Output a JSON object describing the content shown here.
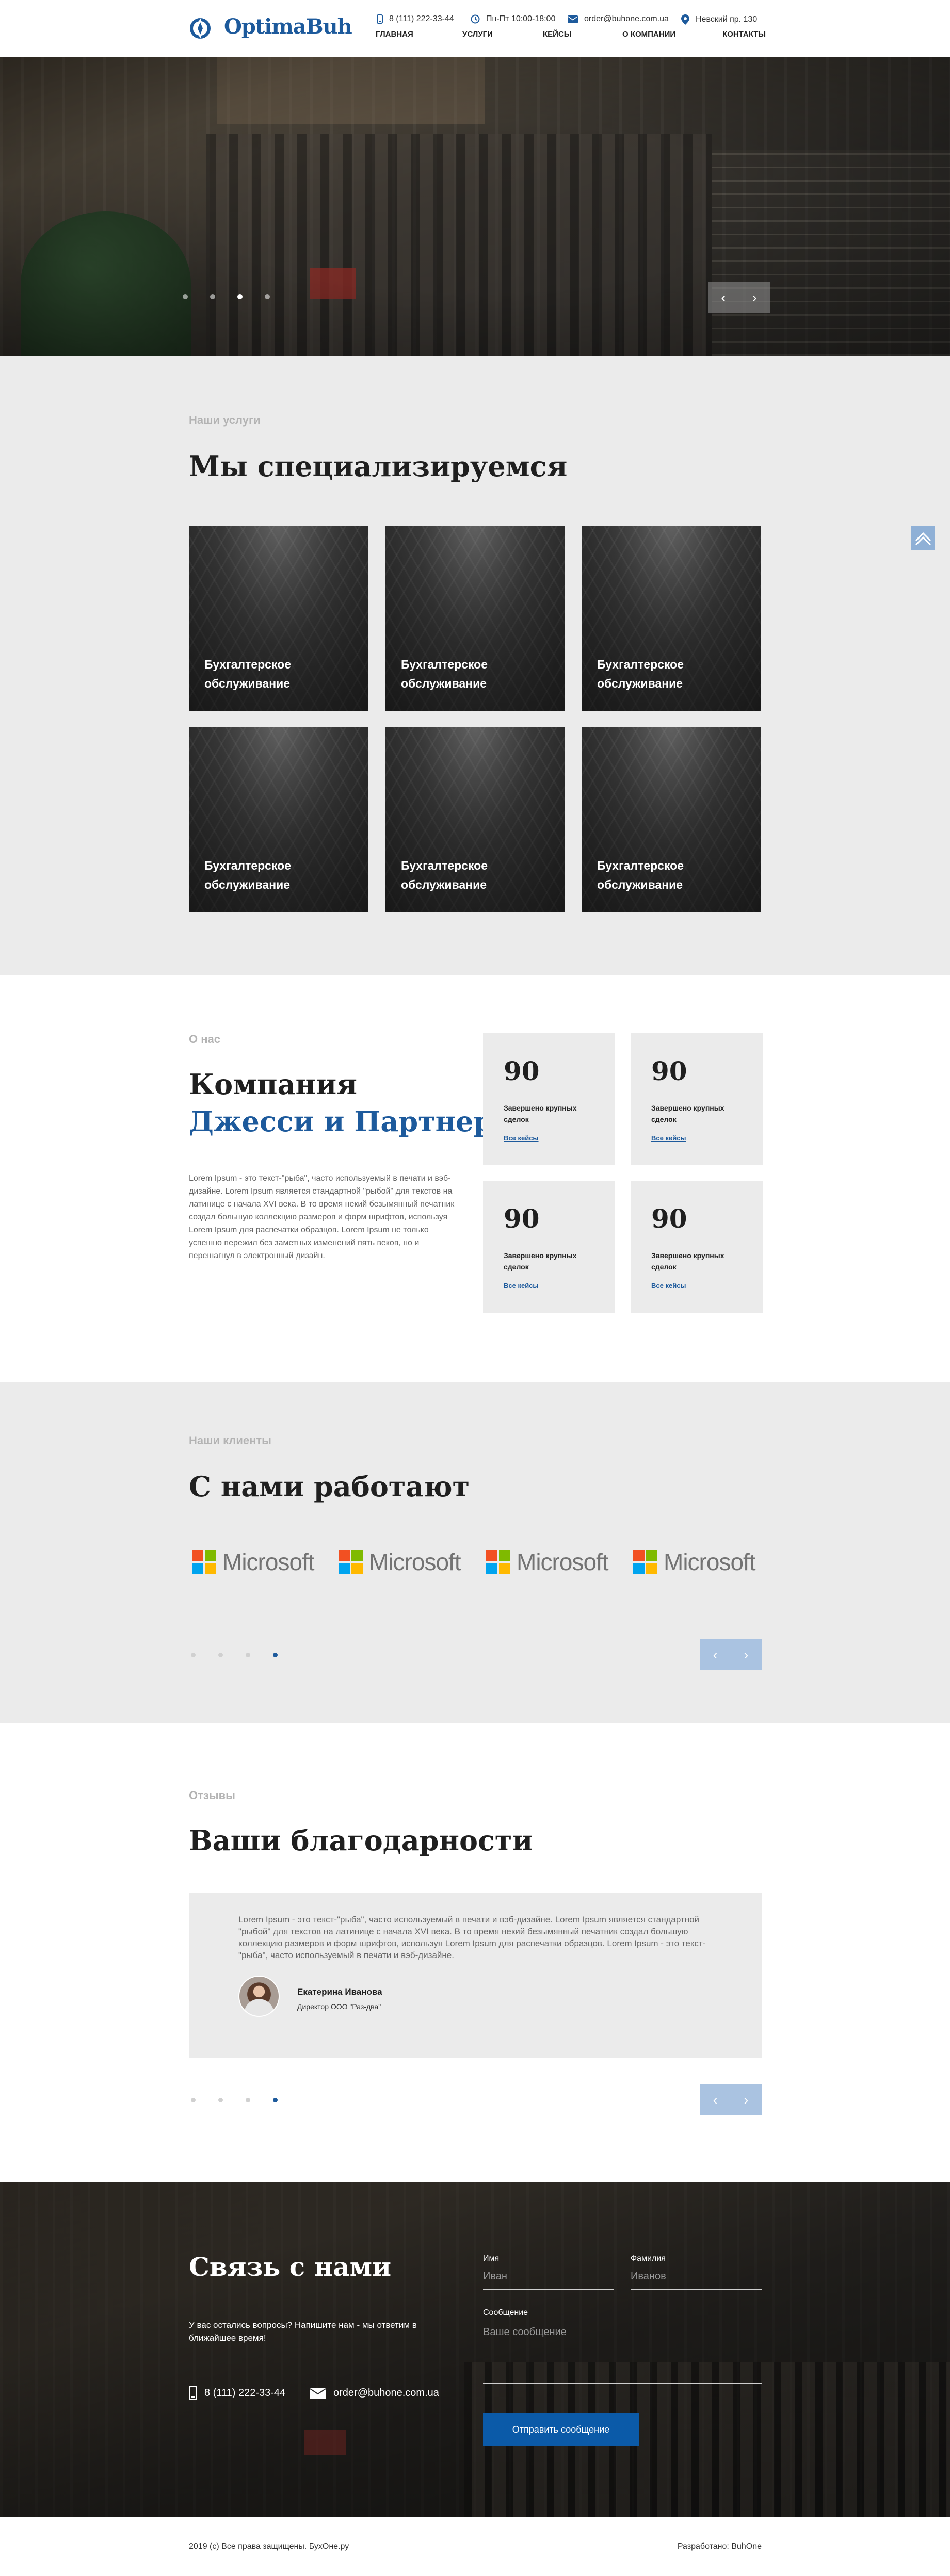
{
  "header": {
    "logo_text": "OptimaBuh",
    "phone": "8 (111) 222-33-44",
    "hours": "Пн-Пт 10:00-18:00",
    "email": "order@buhone.com.ua",
    "address": "Невский пр. 130",
    "nav": [
      "ГЛАВНАЯ",
      "УСЛУГИ",
      "КЕЙСЫ",
      "О КОМПАНИИ",
      "КОНТАКТЫ"
    ],
    "icons": {
      "phone": "phone-icon",
      "clock": "clock-icon",
      "mail": "mail-icon",
      "location": "location-icon"
    }
  },
  "hero": {
    "slide_count": 4,
    "active_slide": 3,
    "prev": "‹",
    "next": "›"
  },
  "services": {
    "eyebrow": "Наши услуги",
    "title": "Мы специализируемся",
    "cards": [
      "Бухгалтерское обслуживание",
      "Бухгалтерское обслуживание",
      "Бухгалтерское обслуживание",
      "Бухгалтерское обслуживание",
      "Бухгалтерское обслуживание",
      "Бухгалтерское обслуживание"
    ]
  },
  "about": {
    "eyebrow": "О нас",
    "title_line1": "Компания",
    "title_line2": "Джесси и Партнеры",
    "text": "Lorem Ipsum - это текст-\"рыба\", часто используемый в печати и вэб-дизайне. Lorem Ipsum является стандартной \"рыбой\" для текстов на латинице с начала XVI века. В то время некий безымянный печатник создал большую коллекцию размеров и форм шрифтов, используя Lorem Ipsum для распечатки образцов. Lorem Ipsum не только успешно пережил без заметных изменений пять веков, но и перешагнул в электронный дизайн.",
    "stats": [
      {
        "number": "90",
        "label": "Завершено крупных сделок",
        "link": "Все кейсы"
      },
      {
        "number": "90",
        "label": "Завершено крупных сделок",
        "link": "Все кейсы"
      },
      {
        "number": "90",
        "label": "Завершено крупных сделок",
        "link": "Все кейсы"
      },
      {
        "number": "90",
        "label": "Завершено крупных сделок",
        "link": "Все кейсы"
      }
    ]
  },
  "clients": {
    "eyebrow": "Наши клиенты",
    "title": "С нами работают",
    "logos": [
      "Microsoft",
      "Microsoft",
      "Microsoft",
      "Microsoft"
    ],
    "logo_colors": [
      "#f25022",
      "#7fba00",
      "#00a4ef",
      "#ffb900"
    ],
    "pager_count": 4,
    "active_page": 4,
    "prev": "‹",
    "next": "›"
  },
  "reviews": {
    "eyebrow": "Отзывы",
    "title": "Ваши благодарности",
    "text": "Lorem Ipsum - это текст-\"рыба\", часто используемый в печати и вэб-дизайне. Lorem Ipsum является стандартной \"рыбой\" для текстов на латинице с начала XVI века. В то время некий безымянный печатник создал большую коллекцию размеров и форм шрифтов, используя Lorem Ipsum для распечатки образцов. Lorem Ipsum - это текст-\"рыба\", часто используемый в печати и вэб-дизайне.",
    "author": "Екатерина Иванова",
    "position": "Директор ООО \"Раз-два\"",
    "pager_count": 4,
    "active_page": 4,
    "prev": "‹",
    "next": "›"
  },
  "contact": {
    "title": "Связь с нами",
    "subtitle": "У вас остались вопросы? Напишите нам - мы ответим в ближайшее время!",
    "phone": "8 (111) 222-33-44",
    "email": "order@buhone.com.ua",
    "form": {
      "name_label": "Имя",
      "name_placeholder": "Иван",
      "surname_label": "Фамилия",
      "surname_placeholder": "Иванов",
      "message_label": "Сообщение",
      "message_placeholder": "Ваше сообщение",
      "submit": "Отправить сообщение"
    }
  },
  "footer": {
    "copyright": "2019 (c) Все права защищены. БухОне.ру",
    "developer": "Разработано: BuhOne"
  },
  "colors": {
    "brand": "#1d5a9c",
    "section_grey": "#ebebeb",
    "button": "#0b5aa8"
  }
}
